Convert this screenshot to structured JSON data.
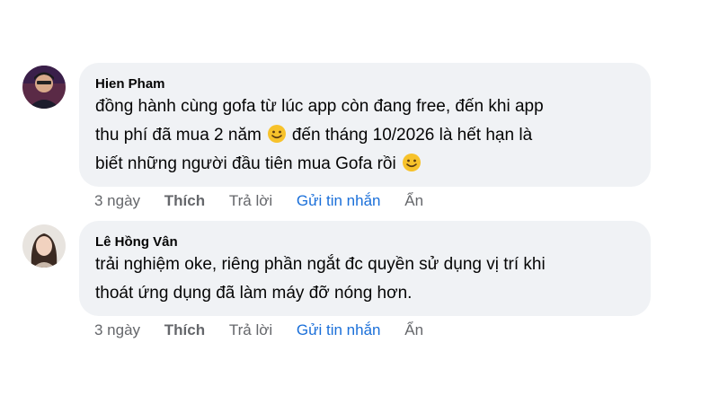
{
  "comments": [
    {
      "author": "Hien Pham",
      "lines": [
        "đồng hành cùng gofa từ lúc app còn đang free, đến khi app",
        "thu phí đã mua 2 năm",
        "đến tháng 10/2026 là hết hạn là",
        "biết những người đầu tiên mua Gofa rồi"
      ],
      "time": "3 ngày",
      "like": "Thích",
      "reply": "Trả lời",
      "message": "Gửi tin nhắn",
      "hide": "Ẩn",
      "emoji": "slightly-smiling-face-icon"
    },
    {
      "author": "Lê Hồng Vân",
      "lines": [
        "trải nghiệm oke, riêng phần ngắt đc quyền sử dụng vị trí khi",
        "thoát ứng dụng đã làm máy đỡ nóng hơn."
      ],
      "time": "3 ngày",
      "like": "Thích",
      "reply": "Trả lời",
      "message": "Gửi tin nhắn",
      "hide": "Ẩn"
    }
  ],
  "colors": {
    "bubble": "#f0f2f5",
    "meta": "#65676b",
    "link": "#1a6fd9"
  }
}
